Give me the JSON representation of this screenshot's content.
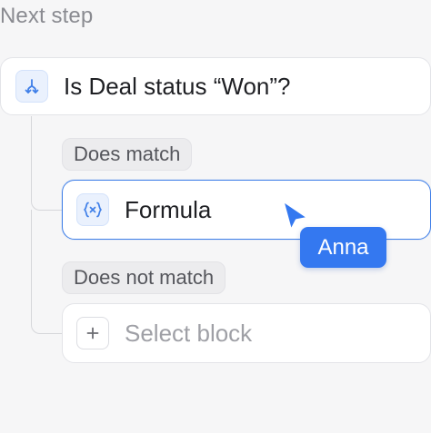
{
  "section": {
    "title": "Next step"
  },
  "condition": {
    "label": "Is Deal status “Won”?",
    "icon": "branch-icon"
  },
  "branches": {
    "match_label": "Does match",
    "no_match_label": "Does not match"
  },
  "formula_block": {
    "label": "Formula",
    "icon": "formula-icon"
  },
  "select_block": {
    "label": "Select block",
    "icon": "plus-icon"
  },
  "collaborator": {
    "name": "Anna",
    "color": "#3478f0"
  },
  "colors": {
    "accent": "#3f7fe8",
    "panel_bg": "#f6f6f7"
  }
}
